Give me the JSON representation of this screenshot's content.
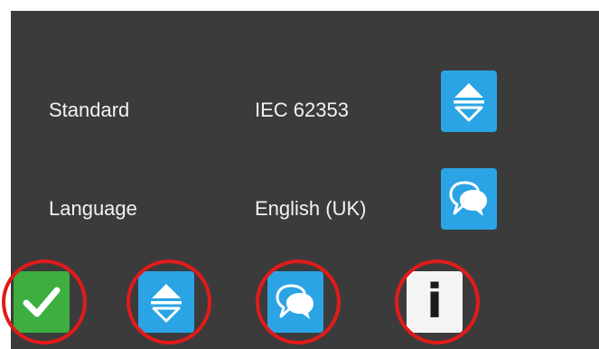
{
  "settings": {
    "standard_label": "Standard",
    "standard_value": "IEC 62353",
    "language_label": "Language",
    "language_value": "English (UK)"
  },
  "icons": {
    "standard_select": "up-down-arrow-icon",
    "language_select": "speech-bubbles-icon",
    "confirm": "checkmark-icon",
    "select": "up-down-arrow-icon",
    "language": "speech-bubbles-icon",
    "info": "info-icon"
  },
  "info_glyph": "i",
  "colors": {
    "background": "#3b3b3b",
    "text": "#f2f2f2",
    "blue_button": "#2aa4e4",
    "green_button": "#3dae3f",
    "white_button": "#f4f4f4",
    "highlight_ring": "#e11b1b"
  }
}
